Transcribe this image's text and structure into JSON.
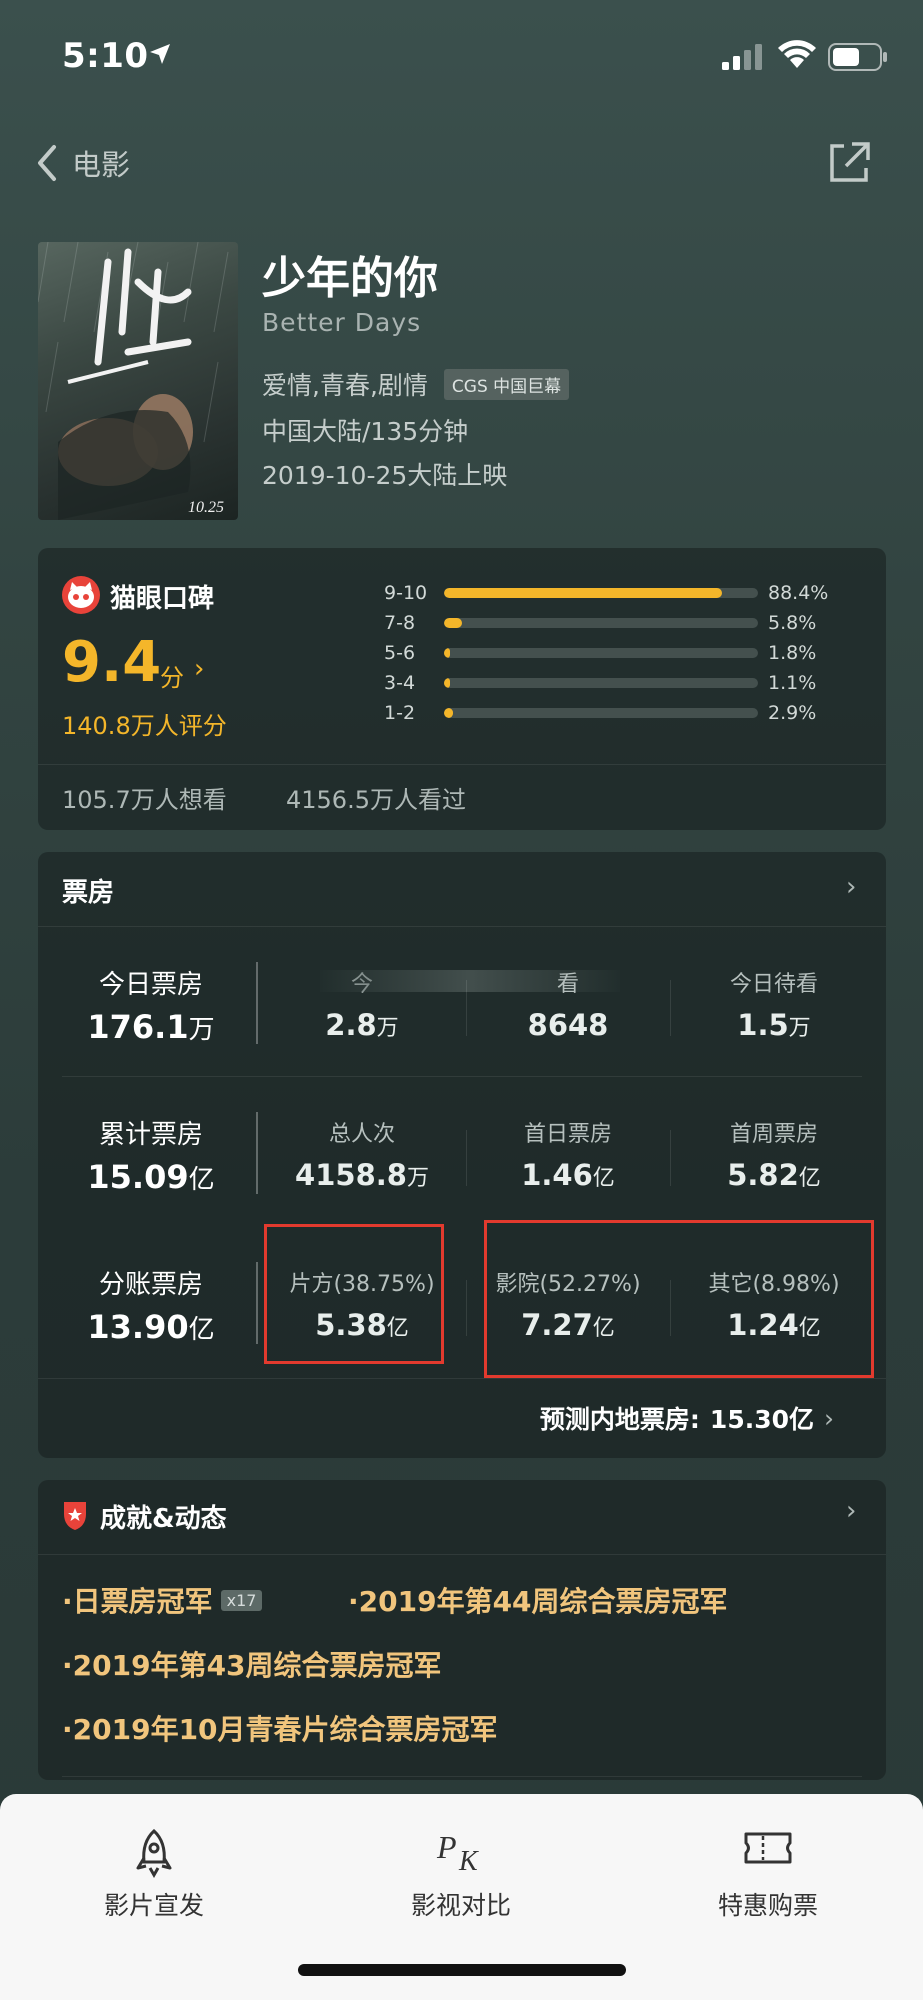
{
  "status": {
    "time": "5:10"
  },
  "nav": {
    "back_label": "电影"
  },
  "movie": {
    "title": "少年的你",
    "en_title": "Better Days",
    "genres": "爱情,青春,剧情",
    "format_badge": "CGS 中国巨幕",
    "region_duration": "中国大陆/135分钟",
    "release": "2019-10-25大陆上映"
  },
  "rating": {
    "source": "猫眼口碑",
    "score": "9.4",
    "score_unit": "分",
    "arrow": "›",
    "raters": "140.8万人评分",
    "distribution": [
      {
        "label": "9-10",
        "pct": "88.4%",
        "fraction": 0.884
      },
      {
        "label": "7-8",
        "pct": "5.8%",
        "fraction": 0.058
      },
      {
        "label": "5-6",
        "pct": "1.8%",
        "fraction": 0.018
      },
      {
        "label": "3-4",
        "pct": "1.1%",
        "fraction": 0.011
      },
      {
        "label": "1-2",
        "pct": "2.9%",
        "fraction": 0.029
      }
    ],
    "want": "105.7万人想看",
    "seen": "4156.5万人看过",
    "accent": "#f4b62a"
  },
  "box_office": {
    "title": "票房",
    "chevron": "›",
    "today": {
      "label": "今日票房",
      "value": "176.1",
      "unit": "万",
      "cols": [
        {
          "label": "今",
          "value": "2.8",
          "unit": "万"
        },
        {
          "label": "看",
          "value": "8648",
          "unit": ""
        },
        {
          "label": "今日待看",
          "value": "1.5",
          "unit": "万"
        }
      ]
    },
    "total": {
      "label": "累计票房",
      "value": "15.09",
      "unit": "亿",
      "cols": [
        {
          "label": "总人次",
          "value": "4158.8",
          "unit": "万"
        },
        {
          "label": "首日票房",
          "value": "1.46",
          "unit": "亿"
        },
        {
          "label": "首周票房",
          "value": "5.82",
          "unit": "亿"
        }
      ]
    },
    "split": {
      "label": "分账票房",
      "value": "13.90",
      "unit": "亿",
      "cols": [
        {
          "label": "片方(38.75%)",
          "value": "5.38",
          "unit": "亿"
        },
        {
          "label": "影院(52.27%)",
          "value": "7.27",
          "unit": "亿"
        },
        {
          "label": "其它(8.98%)",
          "value": "1.24",
          "unit": "亿"
        }
      ]
    },
    "forecast": {
      "label": "预测内地票房:",
      "value": "15.30亿",
      "chevron": "›"
    },
    "highlight_color": "#e23a2e"
  },
  "achievements": {
    "title": "成就&动态",
    "chevron": "›",
    "items": [
      {
        "text": "·日票房冠军",
        "badge": "x17"
      },
      {
        "text": "·2019年第44周综合票房冠军"
      },
      {
        "text": "·2019年第43周综合票房冠军"
      },
      {
        "text": "·2019年10月青春片综合票房冠军"
      }
    ]
  },
  "tabbar": {
    "items": [
      {
        "label": "影片宣发",
        "icon": "rocket-icon"
      },
      {
        "label": "影视对比",
        "icon": "pk-icon"
      },
      {
        "label": "特惠购票",
        "icon": "ticket-icon"
      }
    ]
  }
}
